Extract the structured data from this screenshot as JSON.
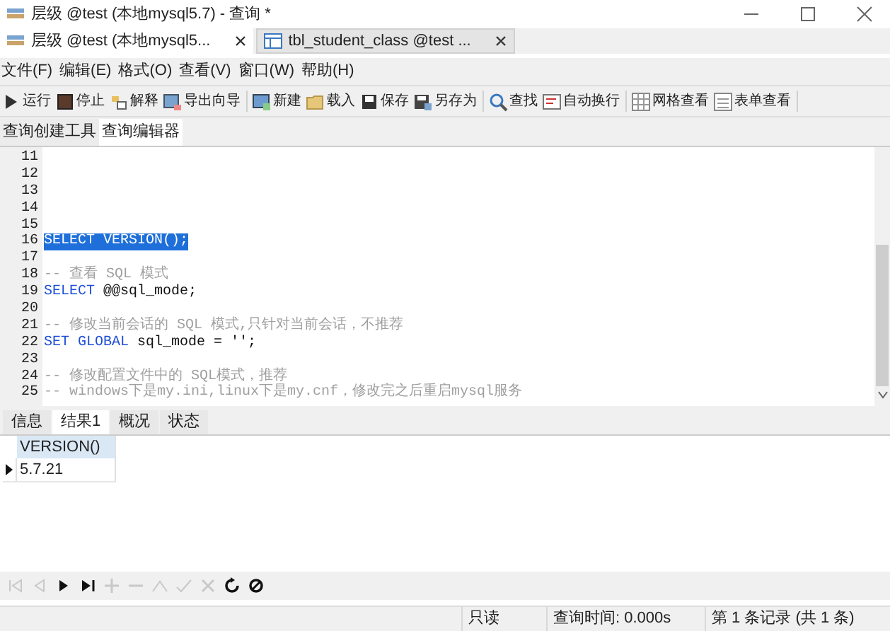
{
  "window": {
    "title": "层级 @test (本地mysql5.7) - 查询 *"
  },
  "doc_tabs": [
    {
      "label": "层级 @test (本地mysql5...",
      "selected": true
    },
    {
      "label": "tbl_student_class @test ...",
      "selected": false
    }
  ],
  "menu": [
    "文件(F)",
    "编辑(E)",
    "格式(O)",
    "查看(V)",
    "窗口(W)",
    "帮助(H)"
  ],
  "toolbar": [
    [
      "运行",
      "停止",
      "解释",
      "导出向导"
    ],
    [
      "新建",
      "载入",
      "保存",
      "另存为"
    ],
    [
      "查找",
      "自动换行"
    ],
    [
      "网格查看",
      "表单查看"
    ]
  ],
  "sub_tabs": [
    {
      "label": "查询创建工具",
      "selected": false
    },
    {
      "label": "查询编辑器",
      "selected": true
    }
  ],
  "editor": {
    "lines": [
      {
        "number": "11"
      },
      {
        "number": "12"
      },
      {
        "number": "13"
      },
      {
        "number": "14"
      },
      {
        "number": "15"
      },
      {
        "number": "16",
        "segments": [
          {
            "kind": "selected",
            "text": "SELECT VERSION();"
          }
        ]
      },
      {
        "number": "17"
      },
      {
        "number": "18",
        "segments": [
          {
            "kind": "comment",
            "text": "-- 查看 SQL 模式"
          }
        ]
      },
      {
        "number": "19",
        "segments": [
          {
            "kind": "keyword",
            "text": "SELECT"
          },
          {
            "kind": "plain",
            "text": " @@sql_mode;"
          }
        ]
      },
      {
        "number": "20"
      },
      {
        "number": "21",
        "segments": [
          {
            "kind": "comment",
            "text": "-- 修改当前会话的 SQL 模式,只针对当前会话，不推荐"
          }
        ]
      },
      {
        "number": "22",
        "segments": [
          {
            "kind": "keyword",
            "text": "SET GLOBAL"
          },
          {
            "kind": "plain",
            "text": " sql_mode = '';"
          }
        ]
      },
      {
        "number": "23"
      },
      {
        "number": "24",
        "segments": [
          {
            "kind": "comment",
            "text": "-- 修改配置文件中的 SQL模式，推荐"
          }
        ]
      },
      {
        "number": "25",
        "segments": [
          {
            "kind": "comment",
            "text": "-- windows下是my.ini,linux下是my.cnf，修改完之后重启mysql服务"
          }
        ]
      }
    ]
  },
  "result_tabs": [
    {
      "label": "信息",
      "selected": false
    },
    {
      "label": "结果1",
      "selected": true
    },
    {
      "label": "概况",
      "selected": false
    },
    {
      "label": "状态",
      "selected": false
    }
  ],
  "result_grid": {
    "columns": [
      "VERSION()"
    ],
    "rows": [
      {
        "cells": [
          "5.7.21"
        ],
        "selected": true
      }
    ]
  },
  "nav_buttons": [
    {
      "disabled": true
    },
    {
      "disabled": true
    },
    {
      "disabled": false
    },
    {
      "disabled": false
    },
    {
      "disabled": true
    },
    {
      "disabled": true
    },
    {
      "disabled": true
    },
    {
      "disabled": true
    },
    {
      "disabled": true
    },
    {
      "disabled": false
    },
    {
      "disabled": false
    }
  ],
  "status_bar": [
    "只读",
    "查询时间: 0.000s",
    "第 1 条记录 (共 1 条)"
  ]
}
